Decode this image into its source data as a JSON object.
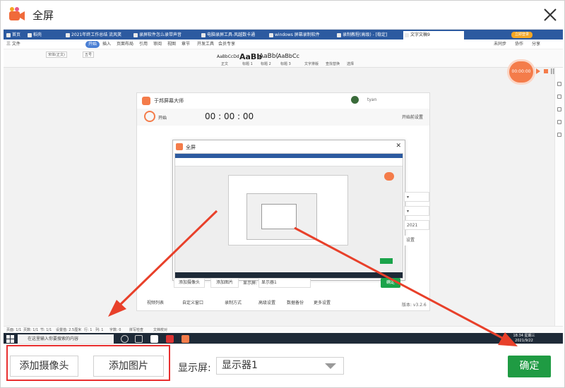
{
  "window": {
    "title": "全屏",
    "colors": {
      "accent": "#1f9b43",
      "highlight": "#e82f2f",
      "arrow": "#e8402a",
      "record_orange": "#f47c4a"
    }
  },
  "preview": {
    "browser_tabs": [
      "首页",
      "稻壳",
      "2021年终工作总结 流风笑",
      "录屏软件怎么录带声音",
      "电脑录屏工具-风越数卡通",
      "windows 屏幕录制软件",
      "录制教程(高级) - [稳定]",
      "文字文稿9"
    ],
    "login_badge": "立即登录",
    "ribbon_menu": [
      "三 文件",
      "开始",
      "插入",
      "页面布局",
      "引用",
      "审阅",
      "视图",
      "章节",
      "开发工具",
      "会员专享"
    ],
    "ribbon_right": [
      "未同步",
      "协作",
      "分享"
    ],
    "font_name": "宋体(正文)",
    "font_size": "五号",
    "styles": [
      "AaBbCcDd",
      "AaBb",
      "AaBb(",
      "AaBbCc"
    ],
    "style_labels": [
      "正文",
      "标题 1",
      "标题 2",
      "标题 3",
      "文字排版",
      "查找替换",
      "选择"
    ],
    "recorder_time": "00:00:00",
    "nested_app": {
      "title": "于邦屏幕大师",
      "user": "tyan",
      "start": "开始",
      "timer": "00 : 00 : 00",
      "tip": "开始前设置",
      "side_items": [
        "▾",
        "▾",
        "2021",
        "设置"
      ],
      "version": "版本: v3.2.6",
      "bottom_buttons": [
        "添加摄像头",
        "添加图片",
        "显示屏:",
        "显示器1"
      ],
      "confirm": "确定",
      "bottom_tabs": [
        "视频列表",
        "自定义窗口",
        "录制方式",
        "高级设置",
        "数据备份",
        "更多设置"
      ],
      "inner_title": "全屏"
    },
    "statusbar": [
      "页面: 1/1",
      "页数: 1/1",
      "节: 1/1",
      "设置值: 2.5厘米",
      "行: 1",
      "列: 1",
      "字数: 0",
      "拼写检查",
      "文档校对"
    ],
    "taskbar_search": "在这里输入你要搜索的内容",
    "clock_time": "18:34 星期三",
    "clock_date": "2021/9/22"
  },
  "controls": {
    "add_camera": "添加摄像头",
    "add_image": "添加图片",
    "display_label": "显示屏:",
    "display_value": "显示器1",
    "confirm": "确定"
  }
}
